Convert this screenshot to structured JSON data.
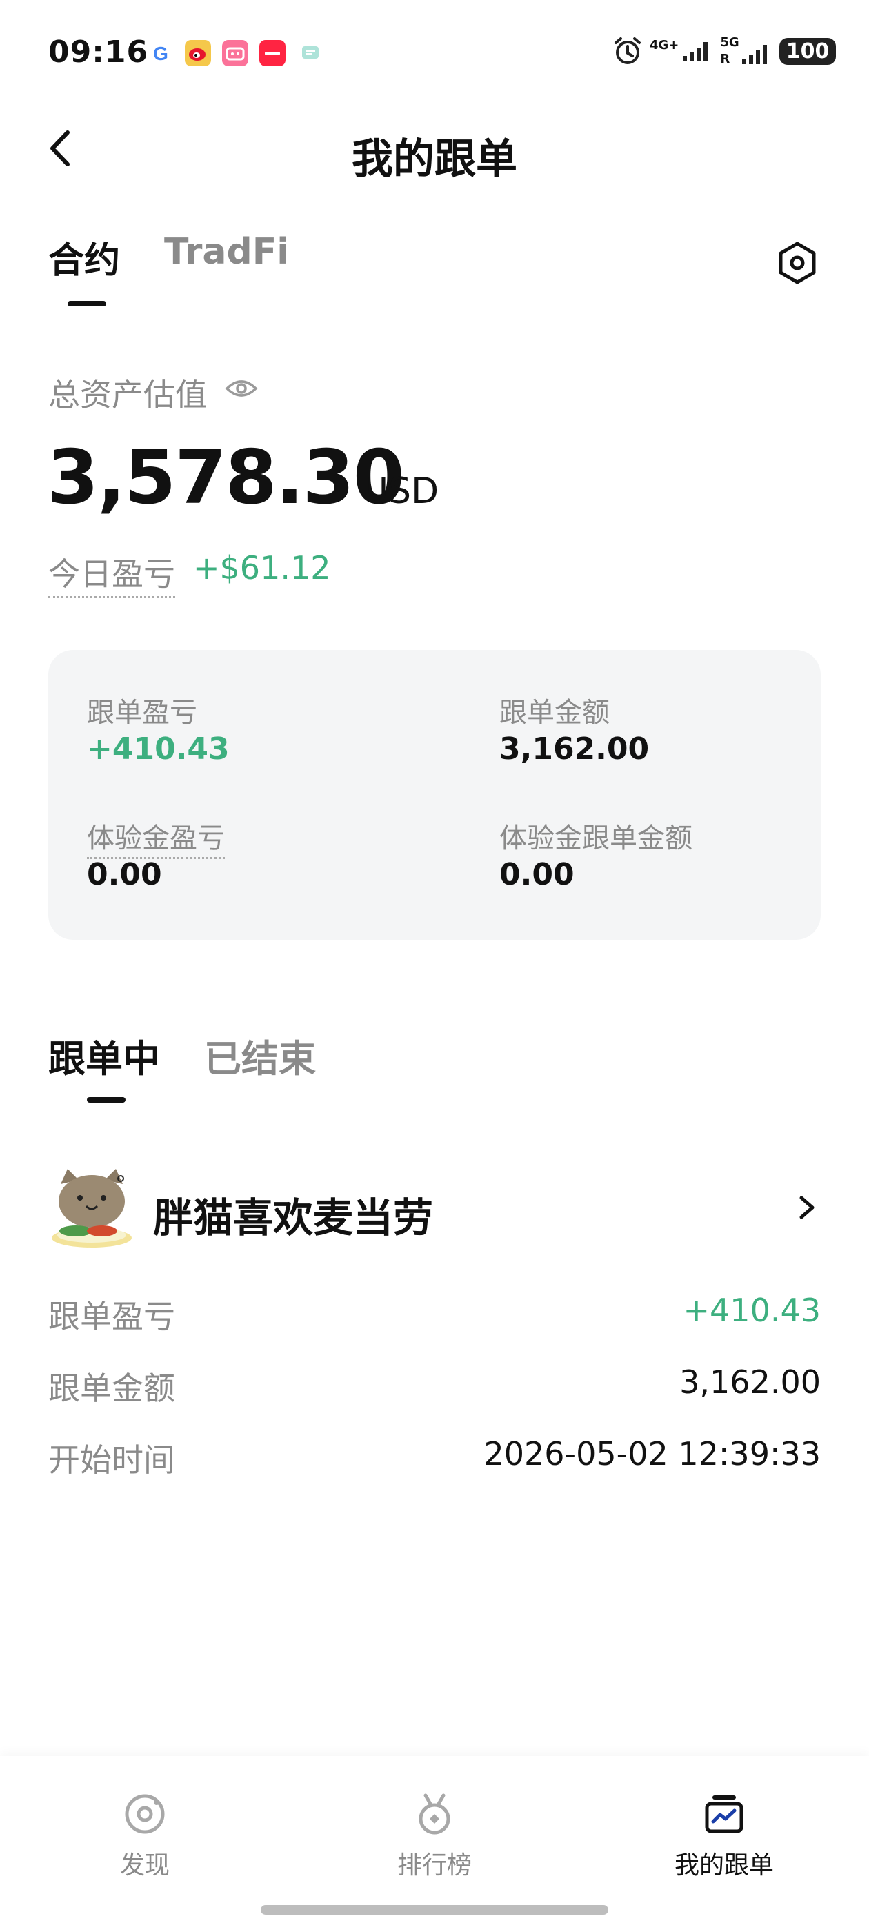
{
  "status_bar": {
    "time": "09:16",
    "network_1": "4G+",
    "network_2": "5G",
    "roaming": "R",
    "battery": "100",
    "app_icons": [
      "google-icon",
      "weibo-icon",
      "bilibili-icon",
      "xiaohongshu-icon",
      "chat-icon"
    ]
  },
  "header": {
    "title": "我的跟单"
  },
  "tabs": [
    {
      "label": "合约",
      "active": true
    },
    {
      "label": "TradFi",
      "active": false
    }
  ],
  "assets": {
    "label": "总资产估值",
    "value": "3,578.30",
    "unit": "USD",
    "today_label": "今日盈亏",
    "today_value": "+$61.12"
  },
  "summary": {
    "follow_pnl_label": "跟单盈亏",
    "follow_pnl_value": "+410.43",
    "follow_amount_label": "跟单金额",
    "follow_amount_value": "3,162.00",
    "trial_pnl_label": "体验金盈亏",
    "trial_pnl_value": "0.00",
    "trial_amount_label": "体验金跟单金额",
    "trial_amount_value": "0.00"
  },
  "order_tabs": [
    {
      "label": "跟单中",
      "active": true
    },
    {
      "label": "已结束",
      "active": false
    }
  ],
  "order": {
    "trader_name": "胖猫喜欢麦当劳",
    "rows": [
      {
        "label": "跟单盈亏",
        "value": "+410.43",
        "positive": true
      },
      {
        "label": "跟单金额",
        "value": "3,162.00",
        "positive": false
      },
      {
        "label": "开始时间",
        "value": "2026-05-02 12:39:33",
        "positive": false
      }
    ]
  },
  "bottom_nav": [
    {
      "label": "发现",
      "icon": "discover-icon",
      "active": false
    },
    {
      "label": "排行榜",
      "icon": "medal-icon",
      "active": false
    },
    {
      "label": "我的跟单",
      "icon": "my-orders-icon",
      "active": true
    }
  ],
  "colors": {
    "positive": "#3daf7f",
    "muted": "#8a8a8a",
    "card_bg": "#f4f5f6",
    "nav_active_icon": "#1a3ea8"
  }
}
